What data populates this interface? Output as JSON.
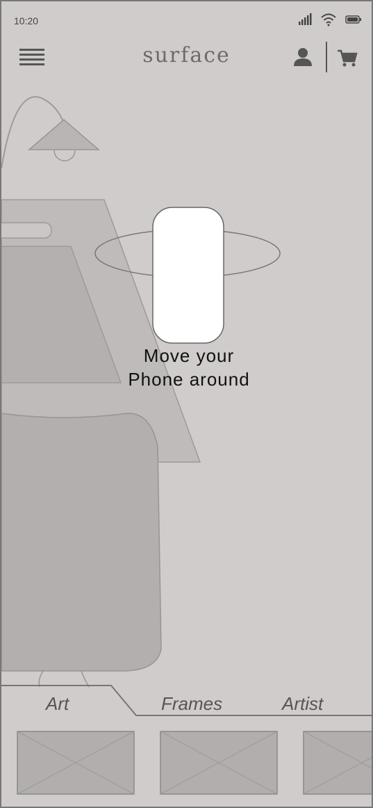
{
  "status_bar": {
    "time": "10:20"
  },
  "header": {
    "brand": "surface"
  },
  "ar_hint": {
    "line1": "Move your",
    "line2": "Phone around"
  },
  "tabs": [
    {
      "label": "Art",
      "active": true
    },
    {
      "label": "Frames",
      "active": false
    },
    {
      "label": "Artist",
      "active": false
    }
  ],
  "thumbnails_visible": 3
}
